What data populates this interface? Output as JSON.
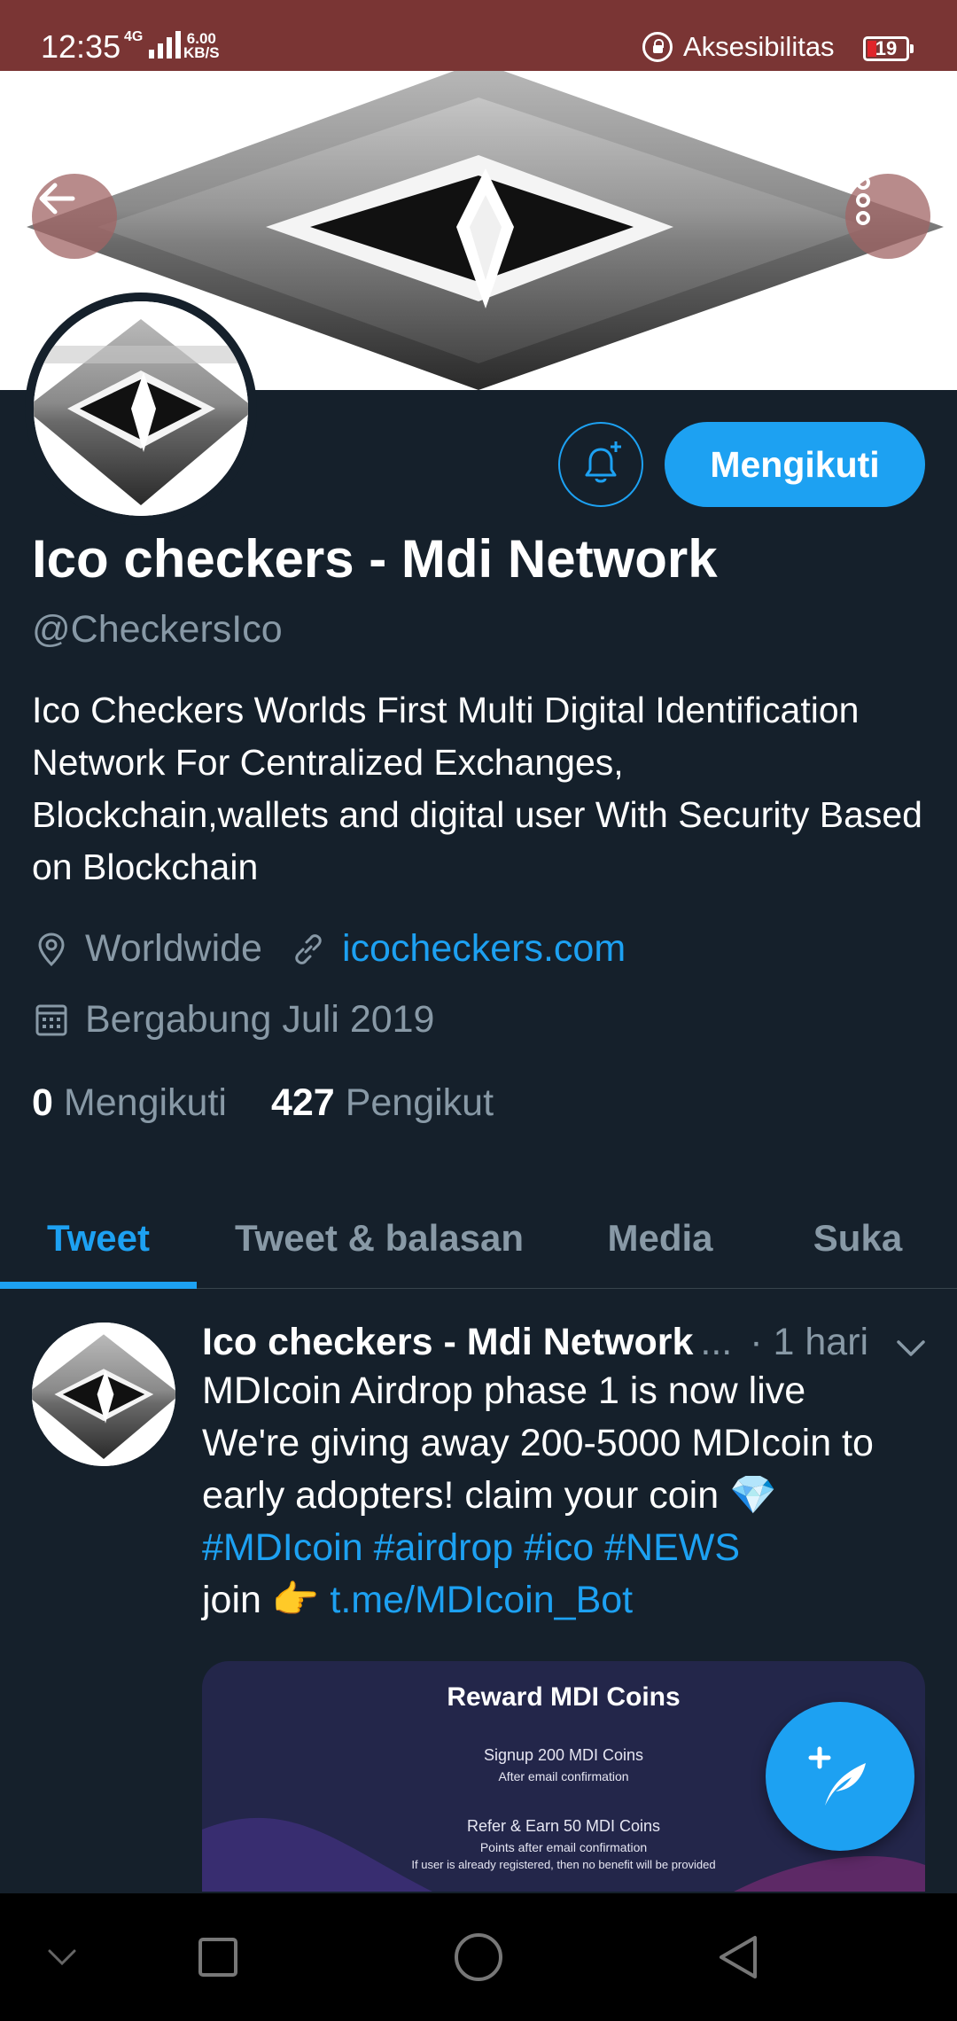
{
  "status_bar": {
    "time": "12:35",
    "network": "4G",
    "speed_value": "6.00",
    "speed_unit": "KB/S",
    "accessibility_label": "Aksesibilitas",
    "battery_level": "19"
  },
  "profile": {
    "display_name": "Ico checkers - Mdi Network",
    "handle": "@CheckersIco",
    "bio": "Ico Checkers Worlds First Multi Digital Identification Network For Centralized Exchanges, Blockchain,wallets and digital user  With Security Based on Blockchain",
    "location": "Worldwide",
    "website": "icocheckers.com",
    "joined": "Bergabung Juli 2019",
    "following_count": "0",
    "following_label": "Mengikuti",
    "followers_count": "427",
    "followers_label": "Pengikut",
    "follow_button_label": "Mengikuti"
  },
  "tabs": [
    {
      "label": "Tweet",
      "active": true
    },
    {
      "label": "Tweet & balasan",
      "active": false
    },
    {
      "label": "Media",
      "active": false
    },
    {
      "label": "Suka",
      "active": false
    }
  ],
  "tweet": {
    "author": "Ico checkers - Mdi Network",
    "ellipsis": "...",
    "time": "· 1 hari",
    "line1": "MDIcoin Airdrop phase 1 is now live",
    "line2": "We're giving away 200-5000 MDIcoin to",
    "line3": "early adopters! claim your coin 💎",
    "hashtags": "#MDIcoin #airdrop #ico #NEWS",
    "join_prefix": "join 👉 ",
    "join_link": "t.me/MDIcoin_Bot",
    "image": {
      "title": "Reward MDI Coins",
      "line1": "Signup 200 MDI Coins",
      "line2": "After email confirmation",
      "line3": "Refer & Earn 50 MDI Coins",
      "line4": "Points after email confirmation",
      "line5": "If user is already registered, then no benefit will be provided"
    }
  },
  "colors": {
    "accent": "#1da1f2",
    "background": "#15202b",
    "muted_text": "#8899a6",
    "status_bar": "#7a3534"
  },
  "icons": [
    "back-arrow-icon",
    "more-vertical-icon",
    "bell-plus-icon",
    "location-pin-icon",
    "link-icon",
    "calendar-icon",
    "chevron-down-icon",
    "compose-feather-icon",
    "nav-back-icon",
    "nav-home-icon",
    "nav-recents-icon",
    "nav-collapse-icon"
  ]
}
